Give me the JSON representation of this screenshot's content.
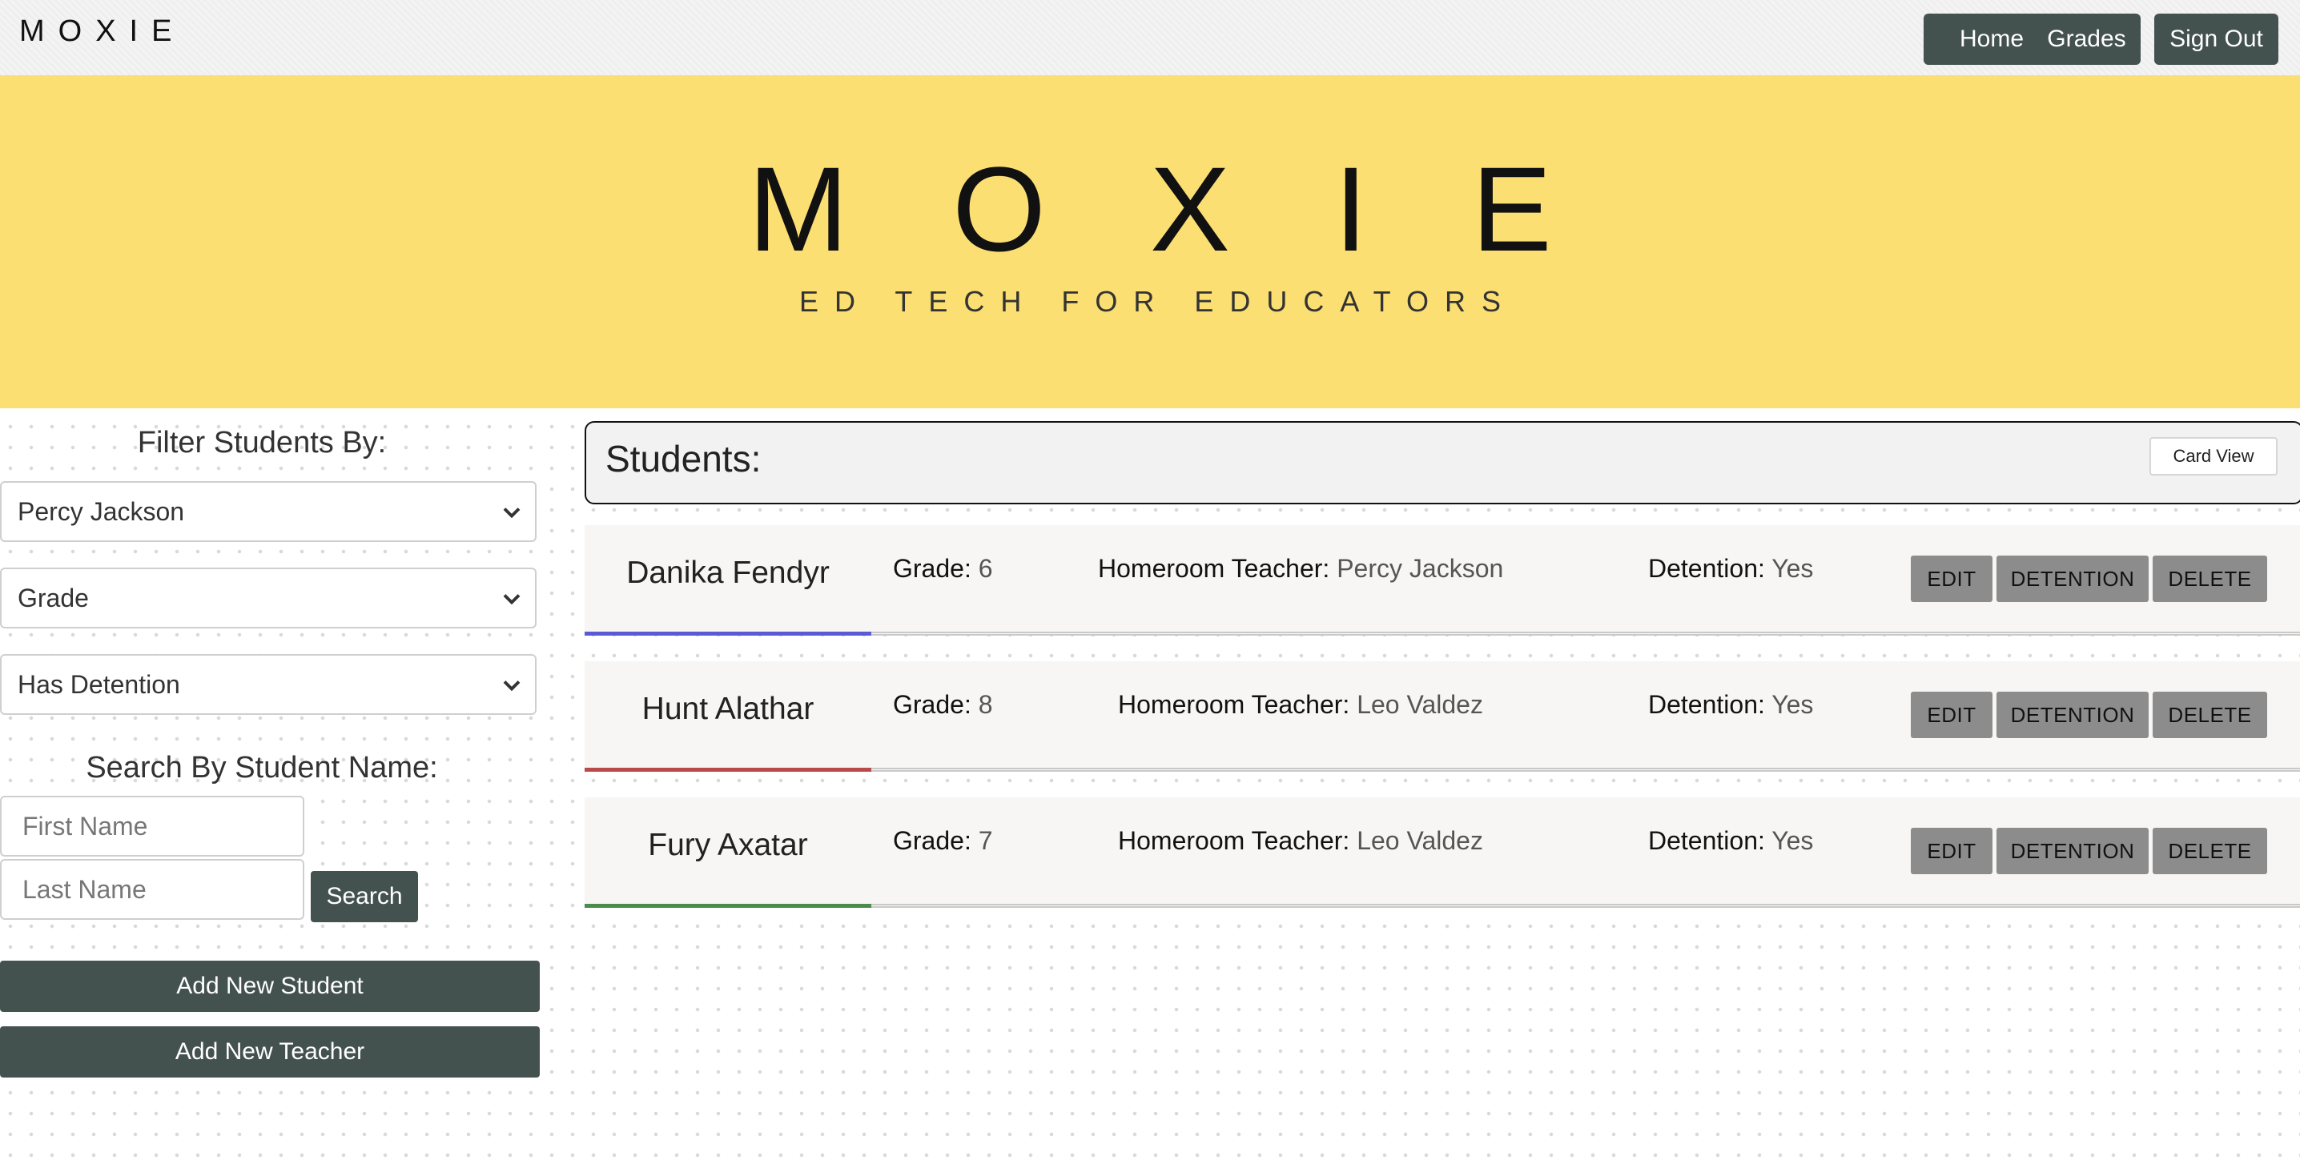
{
  "navbar": {
    "brand": "MOXIE",
    "buttons": {
      "home": "Home",
      "grades": "Grades",
      "sign_out": "Sign Out"
    }
  },
  "hero": {
    "logo": "MOXIE",
    "tagline": "ED TECH FOR EDUCATORS"
  },
  "sidebar": {
    "filter_heading": "Filter Students By:",
    "filters": {
      "teacher": "Percy Jackson",
      "grade": "Grade",
      "detention": "Has Detention"
    },
    "search_heading": "Search By Student Name:",
    "first_name_placeholder": "First Name",
    "last_name_placeholder": "Last Name",
    "search_button": "Search",
    "add_student_button": "Add New Student",
    "add_teacher_button": "Add New Teacher"
  },
  "students_panel": {
    "title": "Students:",
    "card_view_button": "Card View"
  },
  "labels": {
    "grade": "Grade:",
    "teacher": "Homeroom Teacher:",
    "detention": "Detention:"
  },
  "row_buttons": {
    "edit": "EDIT",
    "detention": "DETENTION",
    "delete": "DELETE"
  },
  "students": [
    {
      "name": "Danika Fendyr",
      "grade": "6",
      "teacher": "Percy Jackson",
      "detention": "Yes",
      "accent": "#5a5ad6"
    },
    {
      "name": "Hunt Alathar",
      "grade": "8",
      "teacher": "Leo Valdez",
      "detention": "Yes",
      "accent": "#b84a4a"
    },
    {
      "name": "Fury Axatar",
      "grade": "7",
      "teacher": "Leo Valdez",
      "detention": "Yes",
      "accent": "#4a8c4a"
    }
  ],
  "colors": {
    "nav_button": "#44524f",
    "hero": "#fbdf73",
    "row_button": "#8c8c8c"
  }
}
